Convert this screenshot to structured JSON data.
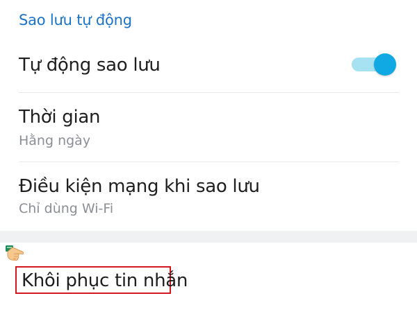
{
  "section": {
    "title": "Sao lưu tự động"
  },
  "settings": {
    "auto_backup": {
      "label": "Tự động sao lưu",
      "enabled": true
    },
    "time": {
      "label": "Thời gian",
      "value": "Hằng ngày"
    },
    "network": {
      "label": "Điều kiện mạng khi sao lưu",
      "value": "Chỉ dùng Wi-Fi"
    },
    "restore": {
      "label": "Khôi phục tin nhắn"
    }
  },
  "colors": {
    "accent": "#1a73c8",
    "toggle_on": "#10a9e3",
    "toggle_track": "#a6e2f2",
    "highlight": "#d3151f"
  },
  "icons": {
    "pointer": "pointing-hand-icon"
  }
}
